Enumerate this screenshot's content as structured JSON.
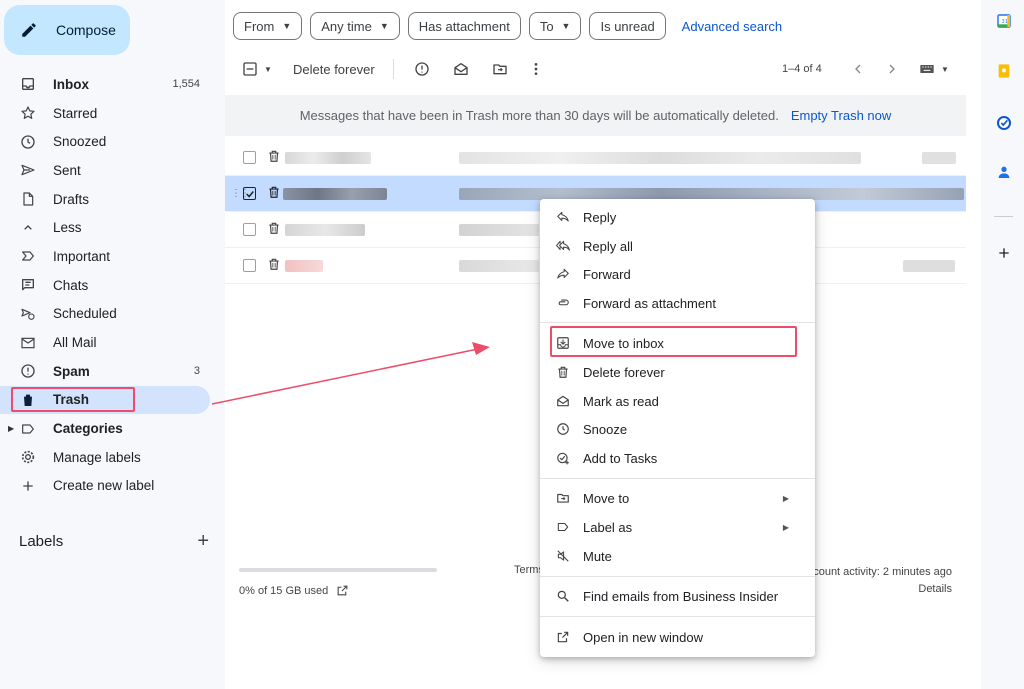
{
  "sidebar": {
    "compose_label": "Compose",
    "items": [
      {
        "label": "Inbox",
        "count": "1,554",
        "icon": "inbox-icon",
        "bold": true
      },
      {
        "label": "Starred",
        "count": "",
        "icon": "star-icon"
      },
      {
        "label": "Snoozed",
        "count": "",
        "icon": "clock-icon"
      },
      {
        "label": "Sent",
        "count": "",
        "icon": "send-icon"
      },
      {
        "label": "Drafts",
        "count": "",
        "icon": "draft-icon"
      },
      {
        "label": "Less",
        "count": "",
        "icon": "chevron-up-icon"
      },
      {
        "label": "Important",
        "count": "",
        "icon": "important-icon"
      },
      {
        "label": "Chats",
        "count": "",
        "icon": "chat-icon"
      },
      {
        "label": "Scheduled",
        "count": "",
        "icon": "schedule-send-icon"
      },
      {
        "label": "All Mail",
        "count": "",
        "icon": "all-mail-icon"
      },
      {
        "label": "Spam",
        "count": "3",
        "icon": "spam-icon",
        "bold": true
      },
      {
        "label": "Trash",
        "count": "",
        "icon": "trash-icon",
        "bold": true,
        "active": true
      },
      {
        "label": "Categories",
        "count": "",
        "icon": "label-icon",
        "bold": true
      },
      {
        "label": "Manage labels",
        "count": "",
        "icon": "gear-icon"
      },
      {
        "label": "Create new label",
        "count": "",
        "icon": "plus-icon"
      }
    ],
    "labels_heading": "Labels"
  },
  "filters": {
    "from": "From",
    "any_time": "Any time",
    "has_attachment": "Has attachment",
    "to": "To",
    "is_unread": "Is unread",
    "advanced_search": "Advanced search"
  },
  "toolbar": {
    "delete_forever": "Delete forever",
    "pagination": "1–4 of 4"
  },
  "banner": {
    "message": "Messages that have been in Trash more than 30 days will be automatically deleted.",
    "action": "Empty Trash now"
  },
  "footer": {
    "storage": "0% of 15 GB used",
    "storage_fraction": 0.0,
    "terms": "Terms",
    "activity": "count activity: 2 minutes ago",
    "details": "Details"
  },
  "menu": {
    "items": [
      {
        "label": "Reply",
        "icon": "reply-icon"
      },
      {
        "label": "Reply all",
        "icon": "reply-all-icon"
      },
      {
        "label": "Forward",
        "icon": "forward-icon"
      },
      {
        "label": "Forward as attachment",
        "icon": "attachment-icon"
      },
      {
        "label": "Move to inbox",
        "icon": "move-to-inbox-icon"
      },
      {
        "label": "Delete forever",
        "icon": "trash-icon"
      },
      {
        "label": "Mark as read",
        "icon": "mark-read-icon"
      },
      {
        "label": "Snooze",
        "icon": "clock-icon"
      },
      {
        "label": "Add to Tasks",
        "icon": "add-task-icon"
      },
      {
        "label": "Move to",
        "icon": "move-to-icon",
        "submenu": true
      },
      {
        "label": "Label as",
        "icon": "label-icon",
        "submenu": true
      },
      {
        "label": "Mute",
        "icon": "mute-icon"
      },
      {
        "label": "Find emails from Business Insider",
        "icon": "search-icon"
      },
      {
        "label": "Open in new window",
        "icon": "open-new-window-icon"
      }
    ]
  },
  "colors": {
    "accent": "#0b57d0",
    "compose_bg": "#c2e7ff",
    "active_nav": "#d3e3fd",
    "selected_row": "#c2dbff",
    "highlight": "#ee4d6a"
  }
}
